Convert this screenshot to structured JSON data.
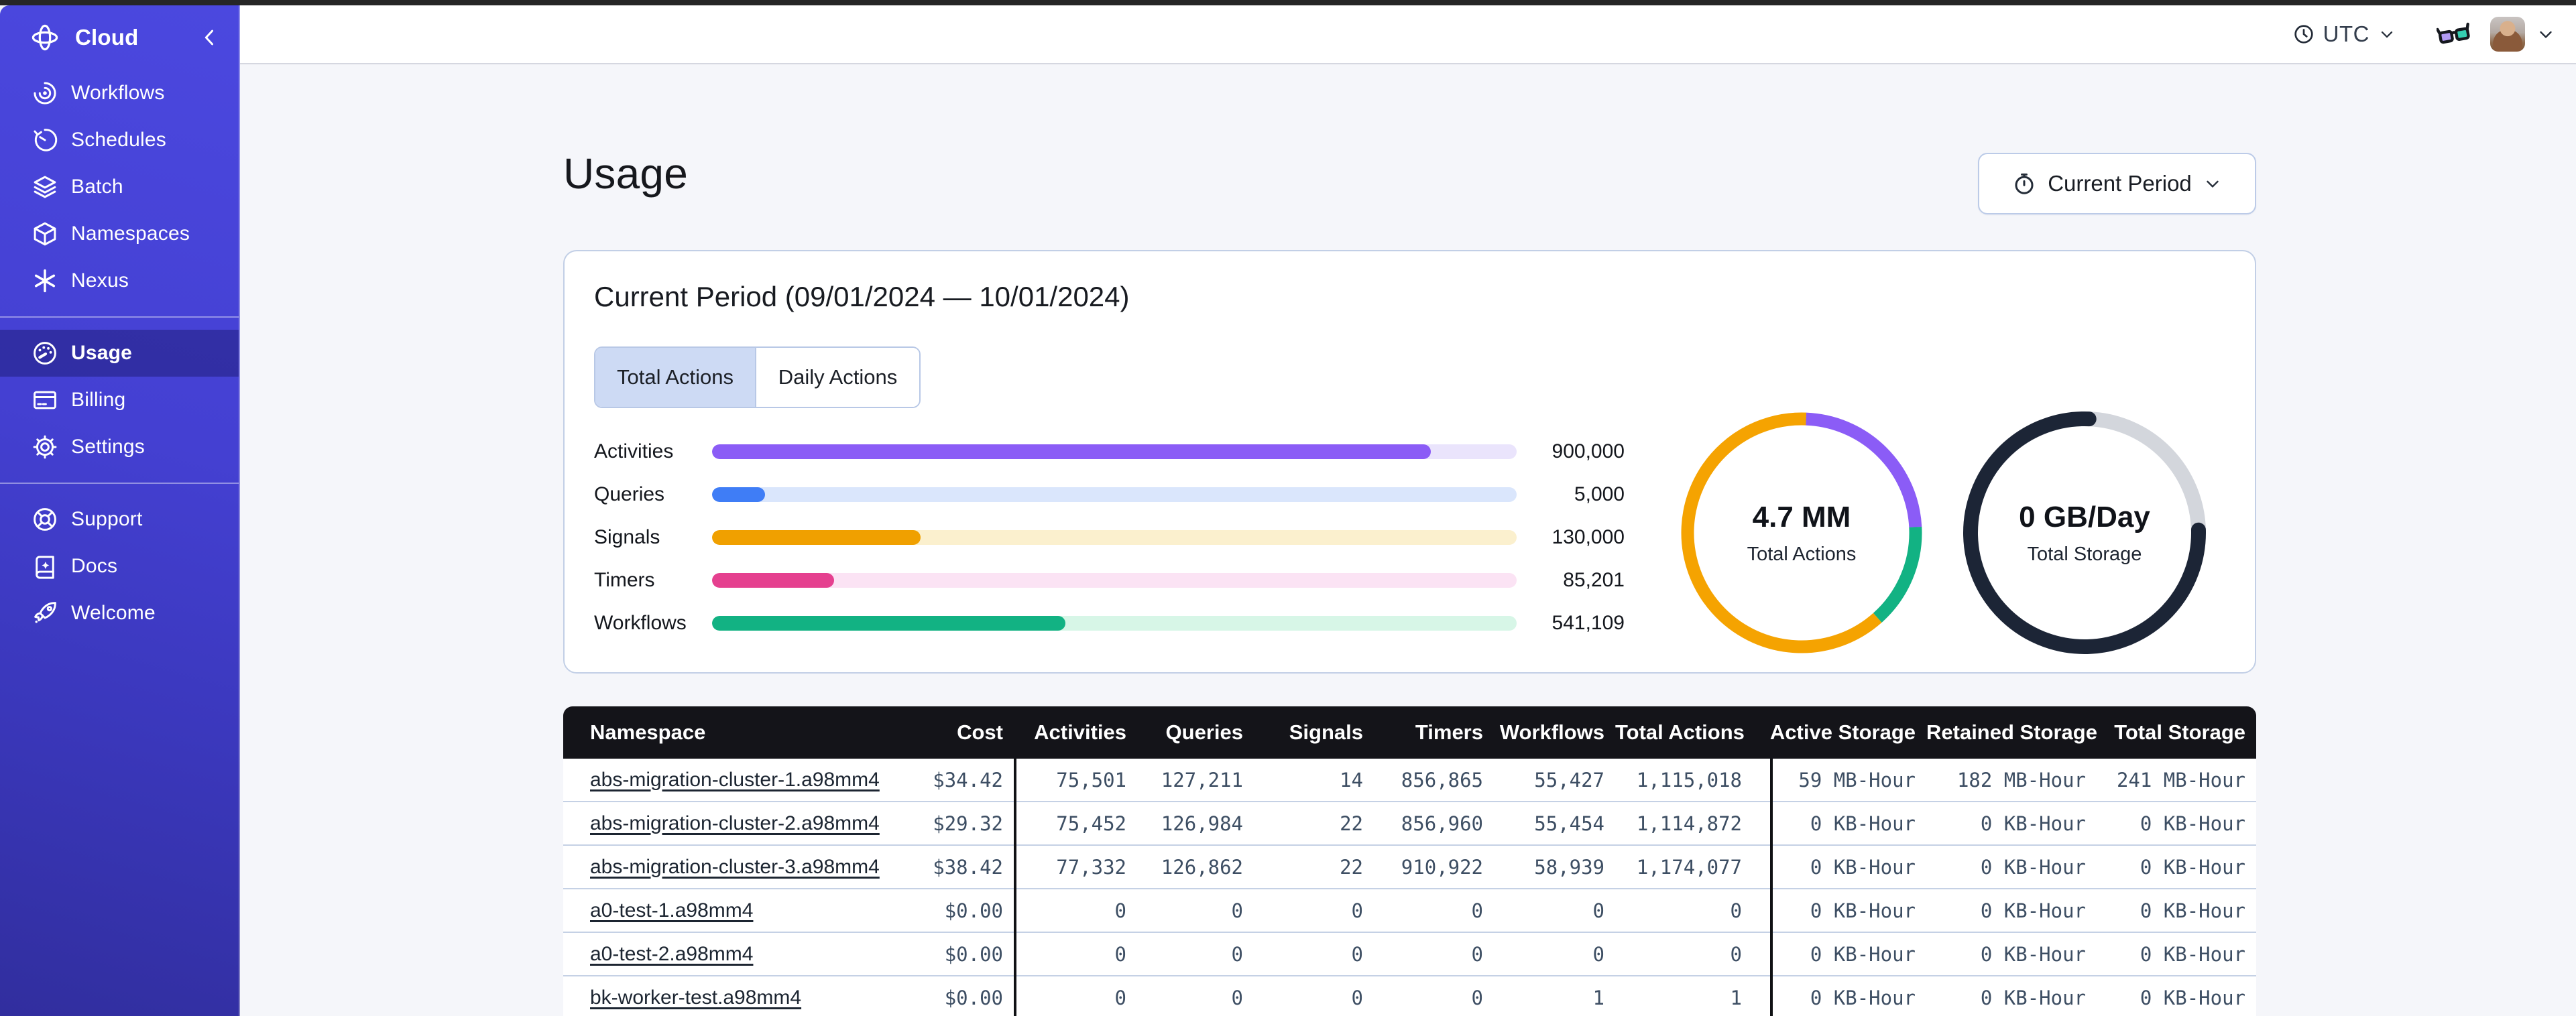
{
  "sidebar": {
    "brand": {
      "label": "Cloud"
    },
    "primary": [
      {
        "label": "Workflows",
        "icon": "workflows-icon"
      },
      {
        "label": "Schedules",
        "icon": "schedules-icon"
      },
      {
        "label": "Batch",
        "icon": "batch-icon"
      },
      {
        "label": "Namespaces",
        "icon": "namespaces-icon"
      },
      {
        "label": "Nexus",
        "icon": "nexus-icon"
      }
    ],
    "account": [
      {
        "label": "Usage",
        "icon": "usage-icon",
        "active": true
      },
      {
        "label": "Billing",
        "icon": "billing-icon"
      },
      {
        "label": "Settings",
        "icon": "settings-icon"
      }
    ],
    "secondary": [
      {
        "label": "Support",
        "icon": "support-icon"
      },
      {
        "label": "Docs",
        "icon": "docs-icon"
      },
      {
        "label": "Welcome",
        "icon": "welcome-icon"
      }
    ],
    "colors": {
      "background_top": "#4B48DF",
      "background_bottom": "#312E9E",
      "active_item": "rgba(13,12,74,0.34)"
    }
  },
  "topbar": {
    "timezone": "UTC"
  },
  "page": {
    "title": "Usage",
    "period_button": {
      "label": "Current Period"
    }
  },
  "usage_card": {
    "title": "Current Period (09/01/2024 — 10/01/2024)",
    "tabs": [
      {
        "label": "Total Actions",
        "active": true
      },
      {
        "label": "Daily Actions",
        "active": false
      }
    ],
    "bars": [
      {
        "label": "Activities",
        "value": "900,000",
        "fraction": 0.893,
        "color": "#8B5CF6",
        "track": "#EAE4FC"
      },
      {
        "label": "Queries",
        "value": "5,000",
        "fraction": 0.066,
        "color": "#3F7DF6",
        "track": "#DAE6FC"
      },
      {
        "label": "Signals",
        "value": "130,000",
        "fraction": 0.259,
        "color": "#F0A000",
        "track": "#FBF0CE"
      },
      {
        "label": "Timers",
        "value": "85,201",
        "fraction": 0.152,
        "color": "#E5408F",
        "track": "#FBE3F4"
      },
      {
        "label": "Workflows",
        "value": "541,109",
        "fraction": 0.439,
        "color": "#12B283",
        "track": "#D7F6E7"
      }
    ],
    "donuts": [
      {
        "value": "4.7 MM",
        "label": "Total Actions",
        "stroke": 19,
        "linecap": "butt",
        "rotation": 0.006,
        "segments": [
          {
            "color": "#8B5CF6",
            "fraction": 0.236
          },
          {
            "color": "#12B283",
            "fraction": 0.142
          },
          {
            "color": "#F5A301",
            "fraction": 0.622
          }
        ]
      },
      {
        "value": "0 GB/Day",
        "label": "Total Storage",
        "stroke": 22,
        "linecap": "round",
        "rotation": 0.006,
        "segments": [
          {
            "color": "#D3D6DC",
            "fraction": 0.24
          },
          {
            "color": "#1C2536",
            "fraction": 0.76
          }
        ]
      }
    ]
  },
  "table": {
    "columns": [
      "Namespace",
      "Cost",
      "Activities",
      "Queries",
      "Signals",
      "Timers",
      "Workflows",
      "Total Actions",
      "Active Storage",
      "Retained Storage",
      "Total Storage"
    ],
    "rows": [
      [
        "abs-migration-cluster-1.a98mm4",
        "$34.42",
        "75,501",
        "127,211",
        "14",
        "856,865",
        "55,427",
        "1,115,018",
        "59 MB-Hour",
        "182 MB-Hour",
        "241 MB-Hour"
      ],
      [
        "abs-migration-cluster-2.a98mm4",
        "$29.32",
        "75,452",
        "126,984",
        "22",
        "856,960",
        "55,454",
        "1,114,872",
        "0 KB-Hour",
        "0 KB-Hour",
        "0 KB-Hour"
      ],
      [
        "abs-migration-cluster-3.a98mm4",
        "$38.42",
        "77,332",
        "126,862",
        "22",
        "910,922",
        "58,939",
        "1,174,077",
        "0 KB-Hour",
        "0 KB-Hour",
        "0 KB-Hour"
      ],
      [
        "a0-test-1.a98mm4",
        "$0.00",
        "0",
        "0",
        "0",
        "0",
        "0",
        "0",
        "0 KB-Hour",
        "0 KB-Hour",
        "0 KB-Hour"
      ],
      [
        "a0-test-2.a98mm4",
        "$0.00",
        "0",
        "0",
        "0",
        "0",
        "0",
        "0",
        "0 KB-Hour",
        "0 KB-Hour",
        "0 KB-Hour"
      ],
      [
        "bk-worker-test.a98mm4",
        "$0.00",
        "0",
        "0",
        "0",
        "0",
        "1",
        "1",
        "0 KB-Hour",
        "0 KB-Hour",
        "0 KB-Hour"
      ]
    ]
  }
}
